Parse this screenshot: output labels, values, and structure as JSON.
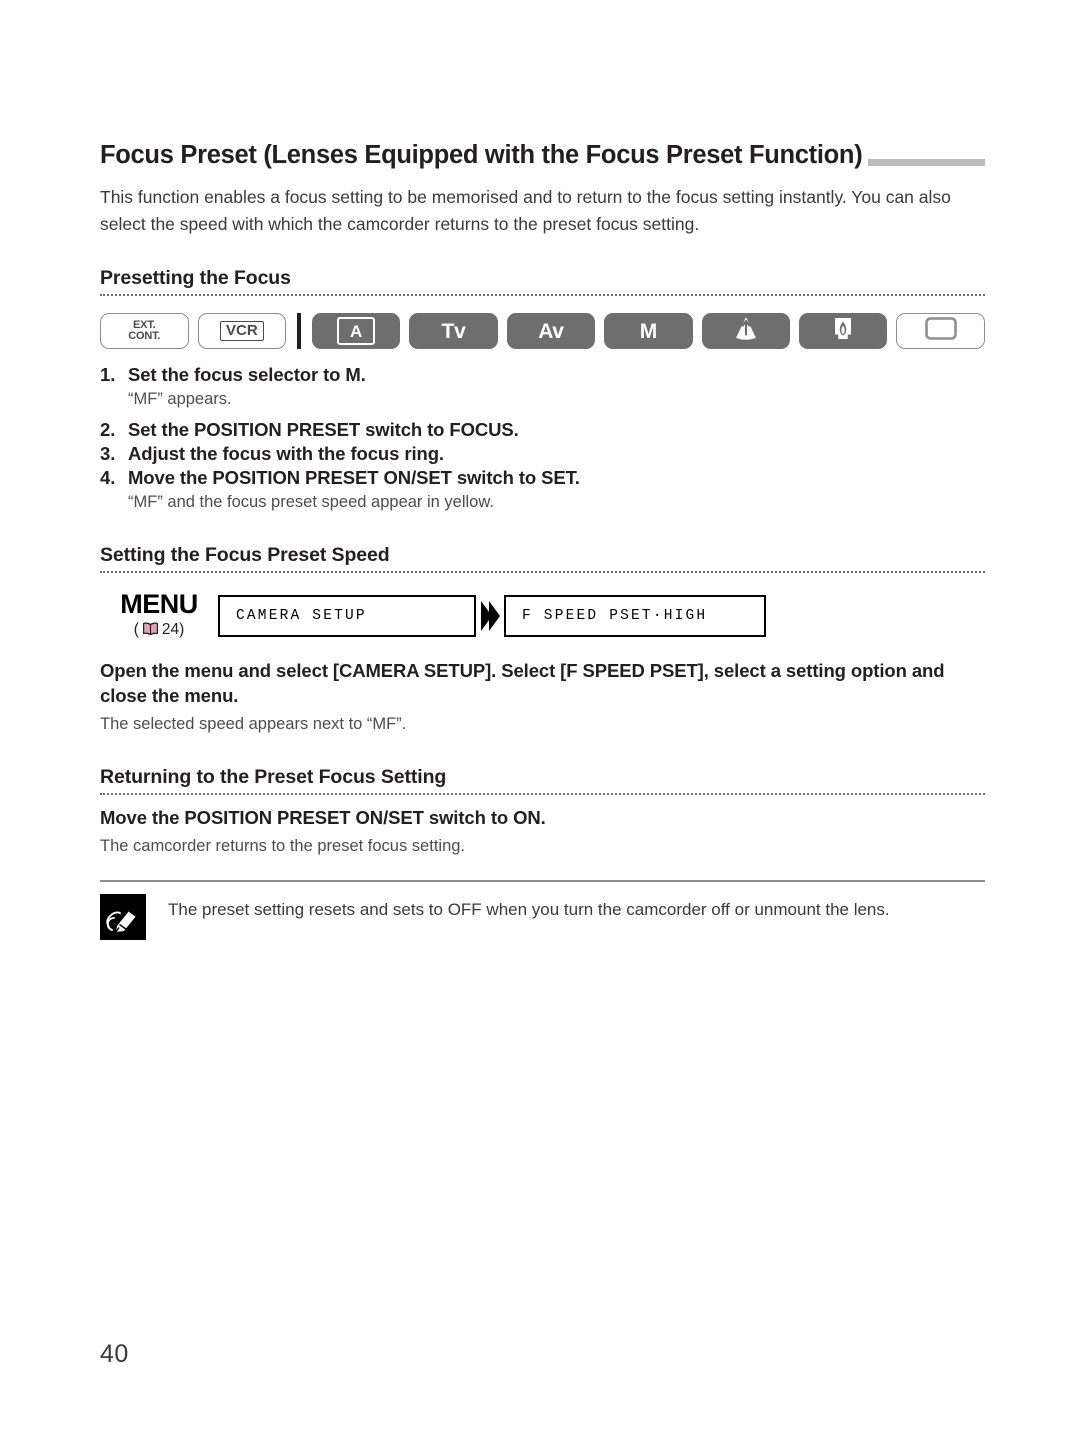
{
  "document": {
    "title": "Focus Preset (Lenses Equipped with the Focus Preset Function)",
    "intro": "This function enables a focus setting to be memorised and to return to the focus setting instantly. You can also select the speed with which the camcorder returns to the preset focus setting.",
    "page_number": "40"
  },
  "mode_row": {
    "ext_cont_line1": "EXT.",
    "ext_cont_line2": "CONT.",
    "vcr": "VCR",
    "auto": "A",
    "tv": "Tv",
    "av": "Av",
    "manual": "M",
    "spotlight": "spotlight-icon",
    "night": "night-icon",
    "card": "card-icon"
  },
  "section_presetting": {
    "heading": "Presetting the Focus",
    "steps": [
      {
        "num": "1.",
        "text": "Set the focus selector to M.",
        "note": "“MF” appears."
      },
      {
        "num": "2.",
        "text": "Set the POSITION PRESET switch to FOCUS.",
        "note": ""
      },
      {
        "num": "3.",
        "text": "Adjust the focus with the focus ring.",
        "note": ""
      },
      {
        "num": "4.",
        "text": "Move the POSITION PRESET ON/SET switch to SET.",
        "note": "“MF” and the focus preset speed appear in yellow."
      }
    ]
  },
  "section_speed": {
    "heading": "Setting the Focus Preset Speed",
    "menu_label": "MENU",
    "menu_ref_open": "(",
    "menu_ref_page": "24)",
    "menu_box_1": "CAMERA SETUP",
    "menu_box_2": "F SPEED PSET·HIGH",
    "instruction": "Open the menu and select [CAMERA SETUP]. Select [F SPEED PSET], select a setting option and close the menu.",
    "note": "The selected speed appears next to “MF”."
  },
  "section_returning": {
    "heading": "Returning to the Preset Focus Setting",
    "instruction": "Move the POSITION PRESET ON/SET switch to ON.",
    "note": "The camcorder returns to the preset focus setting."
  },
  "footnote": {
    "icon": "pencil-note-icon",
    "text": "The preset setting resets and sets to OFF when you turn the camcorder off or unmount the lens."
  },
  "colors": {
    "mode_pill_filled": "#6e6e6e",
    "title_rule": "#bcbcbc",
    "book_icon": "#e8a0b4",
    "text": "#231f20"
  }
}
